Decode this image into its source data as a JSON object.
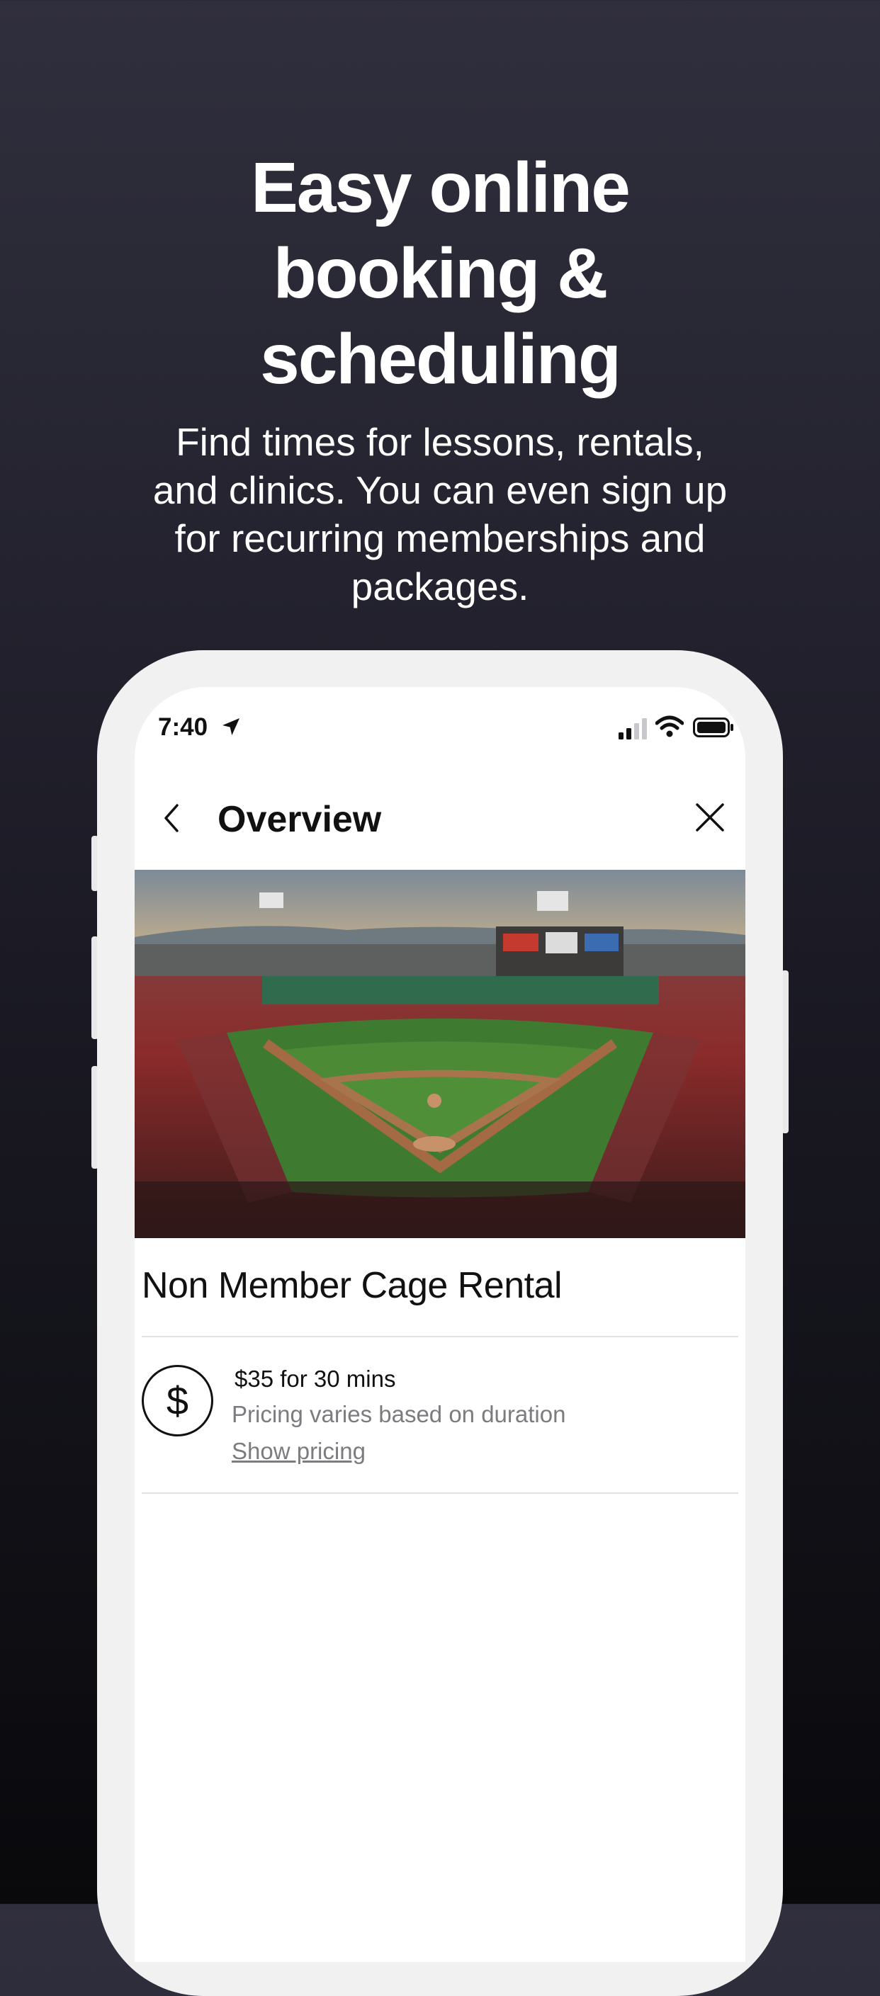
{
  "marketing": {
    "headline": "Easy online\nbooking &\nscheduling",
    "subtitle": "Find times for lessons, rentals,\nand clinics. You can even sign up\nfor recurring memberships and\npackages."
  },
  "status_bar": {
    "time": "7:40",
    "icons": [
      "location-arrow-icon",
      "cellular-signal-icon",
      "wifi-icon",
      "battery-icon"
    ]
  },
  "nav": {
    "title": "Overview",
    "back_icon": "chevron-left-icon",
    "close_icon": "close-icon"
  },
  "listing": {
    "title": "Non Member Cage Rental",
    "price": "$35 for 30 mins",
    "price_note": "Pricing varies based on duration",
    "show_pricing_label": "Show pricing",
    "price_icon": "dollar-icon",
    "price_icon_glyph": "$"
  },
  "colors": {
    "background_top": "#302f3d",
    "background_bottom": "#09090c",
    "phone_frame": "#f1f1f2",
    "secondary_text": "#7b7b80"
  }
}
